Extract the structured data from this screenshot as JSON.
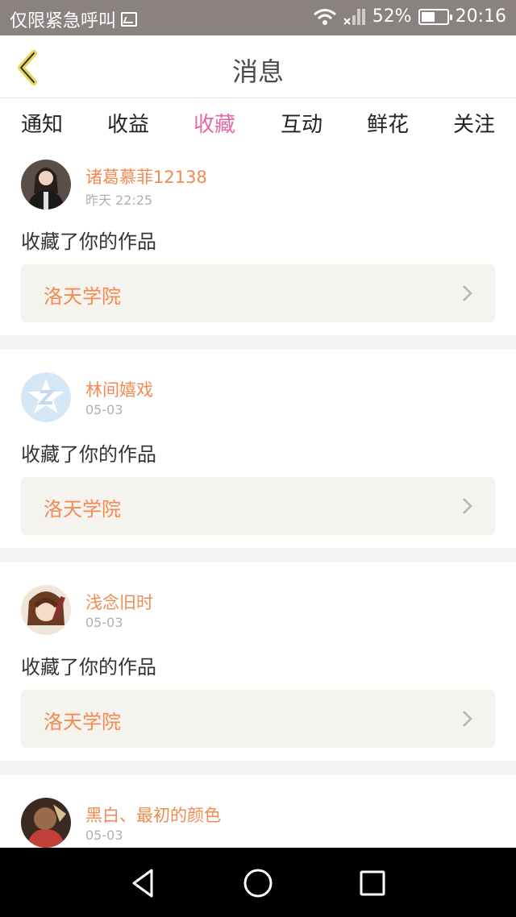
{
  "status_bar": {
    "carrier_text": "仅限紧急呼叫",
    "battery_percent": "52%",
    "battery_level": 0.52,
    "time": "20:16",
    "icons": [
      "image-icon",
      "wifi-icon",
      "no-signal-icon",
      "battery-icon"
    ]
  },
  "header": {
    "title": "消息",
    "back_icon": "chevron-left-icon"
  },
  "tabs": [
    {
      "label": "通知",
      "active": false
    },
    {
      "label": "收益",
      "active": false
    },
    {
      "label": "收藏",
      "active": true
    },
    {
      "label": "互动",
      "active": false
    },
    {
      "label": "鲜花",
      "active": false
    },
    {
      "label": "关注",
      "active": false
    }
  ],
  "notifications": [
    {
      "user": "诸葛慕菲12138",
      "time": "昨天 22:25",
      "message": "收藏了你的作品",
      "work": "洛天学院",
      "avatar": "photo"
    },
    {
      "user": "林间嬉戏",
      "time": "05-03",
      "message": "收藏了你的作品",
      "work": "洛天学院",
      "avatar": "default"
    },
    {
      "user": "浅念旧时",
      "time": "05-03",
      "message": "收藏了你的作品",
      "work": "洛天学院",
      "avatar": "anime"
    },
    {
      "user": "黑白、最初的颜色",
      "time": "05-03",
      "message": "",
      "work": "",
      "avatar": "dark"
    }
  ],
  "colors": {
    "accent_pink": "#e26aa6",
    "name_orange": "#f28a52",
    "work_box_bg": "#f4f3ee",
    "status_bar_bg": "#8a8281"
  },
  "nav_bar": {
    "icons": [
      "back-triangle-icon",
      "home-circle-icon",
      "recents-square-icon"
    ]
  }
}
